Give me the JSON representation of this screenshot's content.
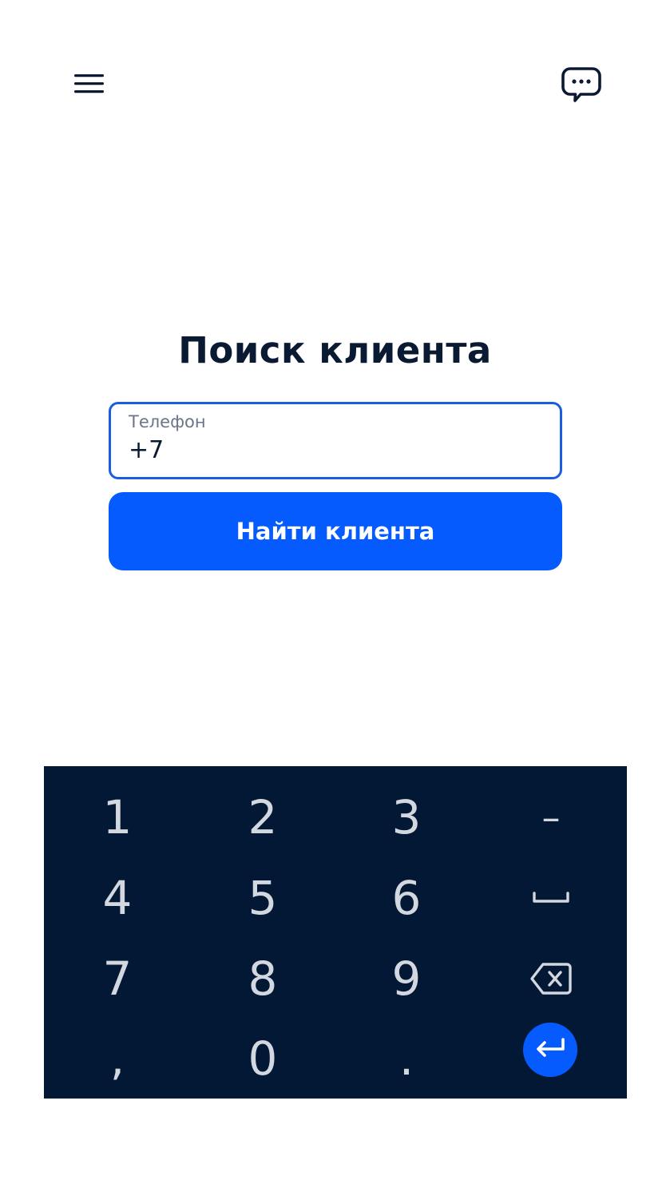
{
  "header": {
    "menu_icon": "hamburger-menu-icon",
    "chat_icon": "chat-bubble-icon"
  },
  "main": {
    "title": "Поиск клиента",
    "phone_field": {
      "label": "Телефон",
      "value": "+7"
    },
    "find_button_label": "Найти клиента"
  },
  "keyboard": {
    "keys": {
      "k1": "1",
      "k2": "2",
      "k3": "3",
      "minus": "–",
      "k4": "4",
      "k5": "5",
      "k6": "6",
      "k7": "7",
      "k8": "8",
      "k9": "9",
      "comma": ",",
      "k0": "0",
      "dot": "."
    },
    "space_icon": "space-bar-icon",
    "backspace_icon": "backspace-icon",
    "enter_icon": "enter-return-icon"
  },
  "colors": {
    "accent": "#055bfd",
    "field_border": "#1a5de3",
    "text_dark": "#0b1a33",
    "label_gray": "#6b7587",
    "keyboard_bg": "#031835",
    "key_text": "#d3d8e0"
  }
}
